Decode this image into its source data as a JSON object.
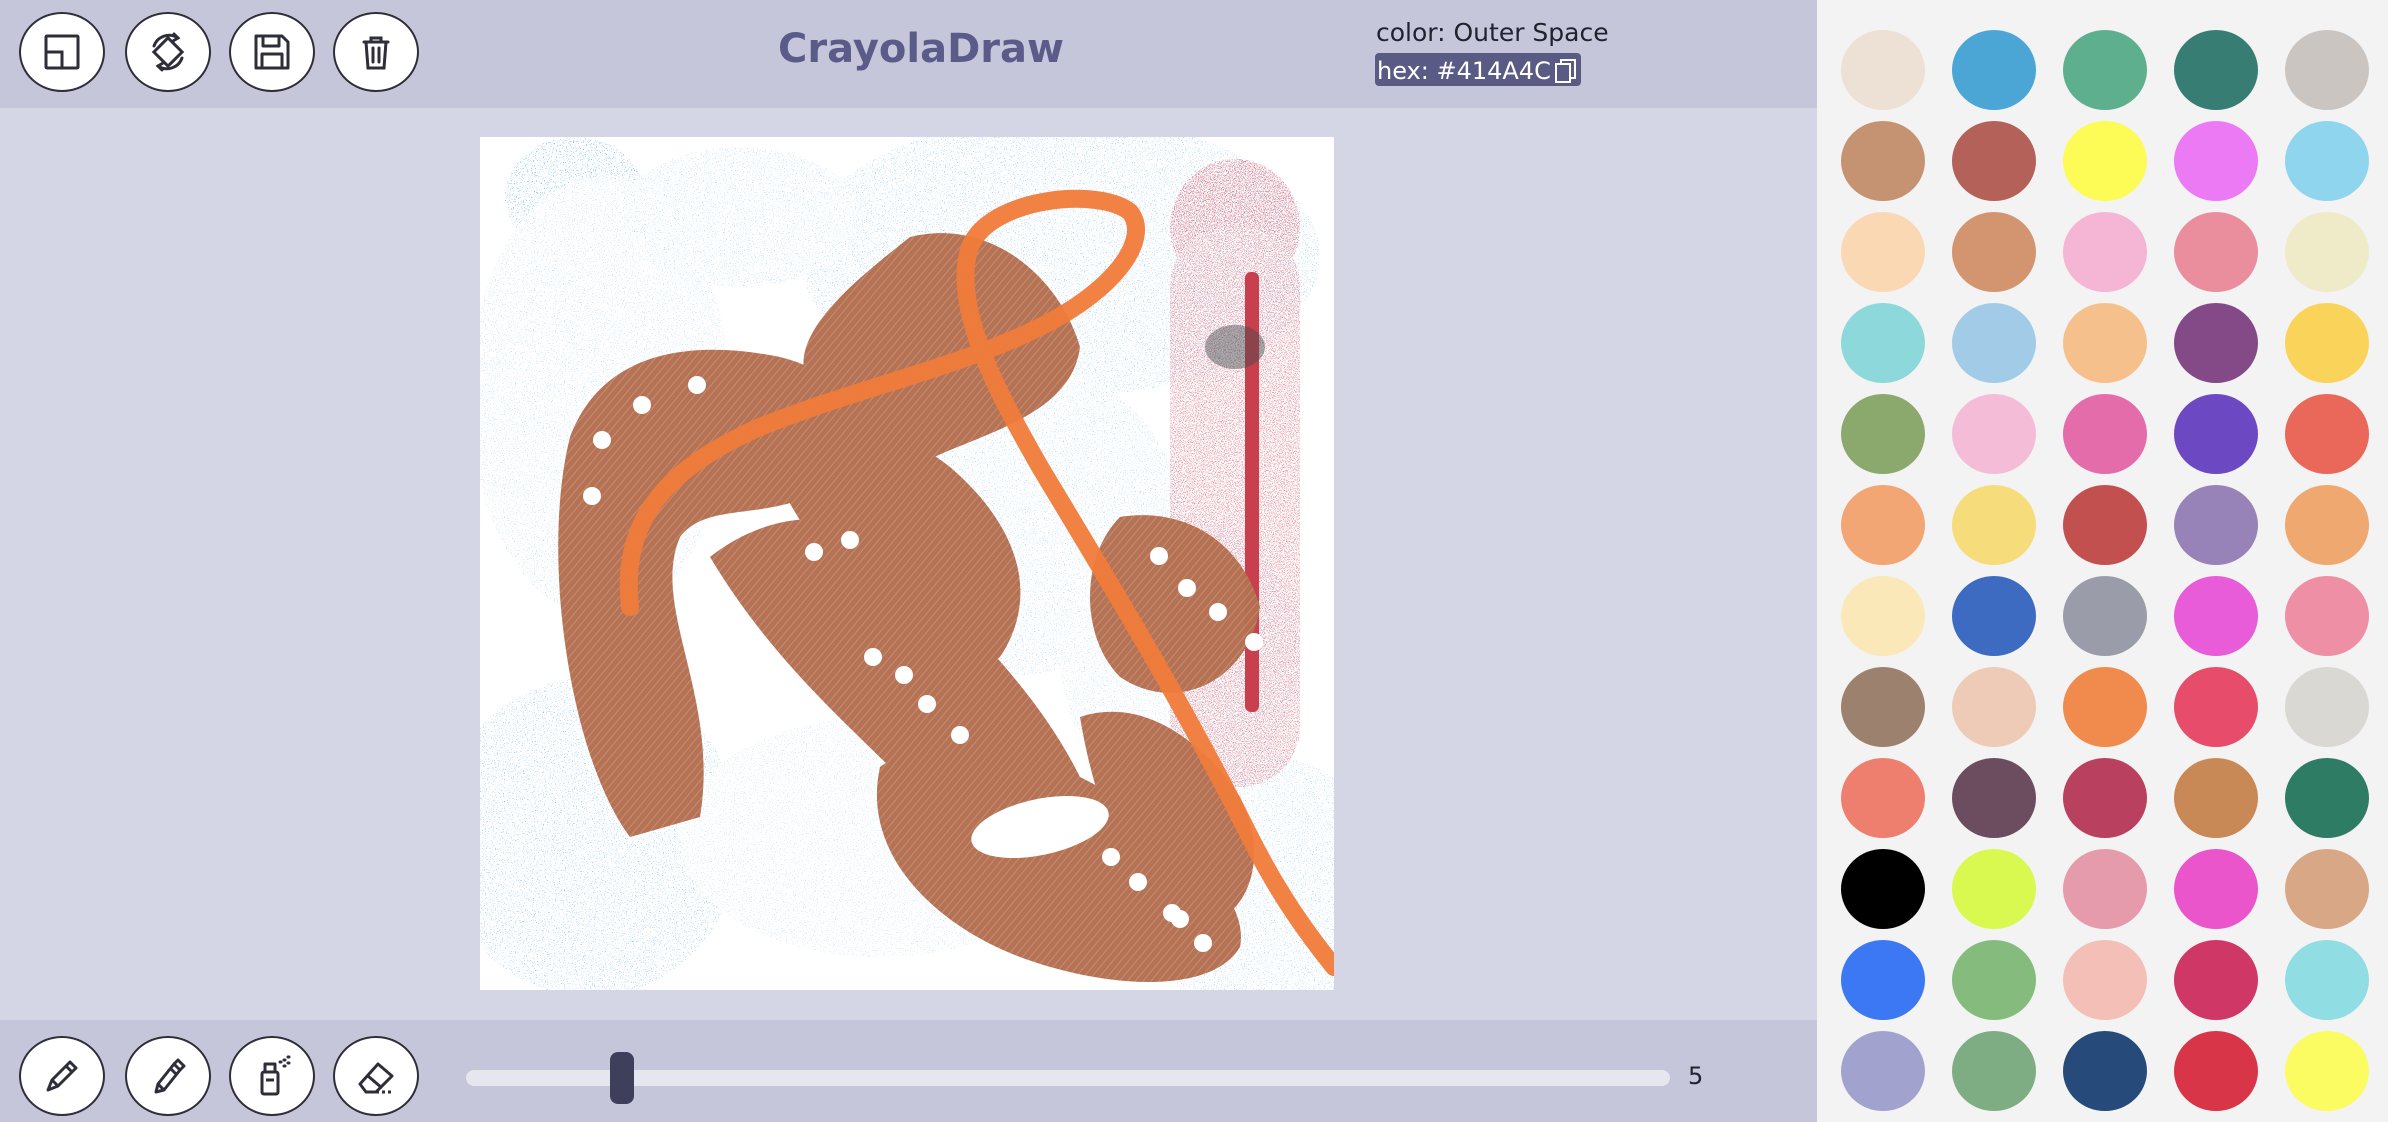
{
  "app": {
    "title": "CrayolaDraw"
  },
  "toolbar_top": [
    {
      "name": "resize-canvas-button",
      "icon": "resize-icon"
    },
    {
      "name": "rotate-button",
      "icon": "rotate-icon"
    },
    {
      "name": "save-button",
      "icon": "save-icon"
    },
    {
      "name": "delete-button",
      "icon": "trash-icon"
    }
  ],
  "selected_color": {
    "name_label": "color: Outer Space",
    "hex_label": "hex: #414A4C",
    "hex": "#414A4C"
  },
  "toolbar_bottom": [
    {
      "name": "crayon-tool-button",
      "icon": "crayon-icon"
    },
    {
      "name": "marker-tool-button",
      "icon": "marker-icon"
    },
    {
      "name": "spray-tool-button",
      "icon": "spray-can-icon"
    },
    {
      "name": "eraser-tool-button",
      "icon": "eraser-icon"
    }
  ],
  "brush_size": {
    "value": 5,
    "display": "5",
    "min": 1,
    "max": 100
  },
  "palette": [
    "#EDE0D4",
    "#4BA6D6",
    "#5EAF8E",
    "#387D74",
    "#CBC5C2",
    "#C69372",
    "#B36159",
    "#FDFB56",
    "#EC7AF4",
    "#8FD5EE",
    "#FBD8B4",
    "#D39570",
    "#F4B6D4",
    "#EA8E9E",
    "#EFEAC8",
    "#8DD8DA",
    "#A2CBE8",
    "#F6C08D",
    "#844A88",
    "#F9D35A",
    "#8BA86D",
    "#F5BCD8",
    "#E46CAA",
    "#6D48C3",
    "#E9685A",
    "#F2A674",
    "#F7DC7C",
    "#C1504F",
    "#9883B8",
    "#EEA870",
    "#FAE8B8",
    "#3D6BC1",
    "#9A9CA9",
    "#E85BD9",
    "#EE8FA6",
    "#9D816F",
    "#EDCBB7",
    "#F08A4D",
    "#E74D6A",
    "#DAD8D3",
    "#EE7F6F",
    "#6C4D5F",
    "#B9405F",
    "#C98957",
    "#2F7C64",
    "#000000",
    "#DAF950",
    "#E59BAB",
    "#EA55CC",
    "#D7A786",
    "#3C77F4",
    "#85BC7E",
    "#F4BFB6",
    "#CE3766",
    "#90DDE3",
    "#A2A2CF",
    "#7FAD83",
    "#264A79",
    "#D93548",
    "#FBFB62"
  ]
}
